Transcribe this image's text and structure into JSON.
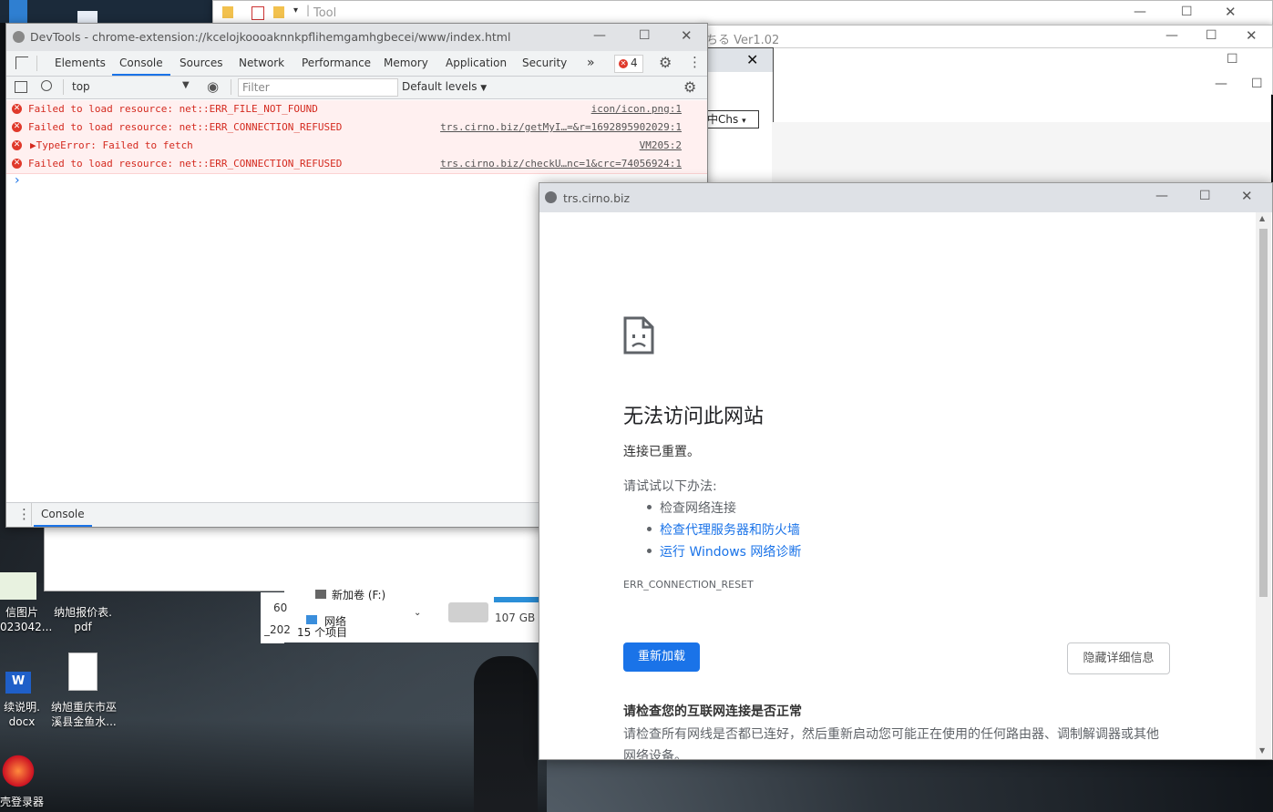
{
  "background_windows": {
    "explorer_title": "Tool",
    "version_window_title": "ちる Ver1.02",
    "language_select": "中Chs",
    "drive_label": "新加卷 (F:)",
    "network_label": "网络",
    "items_count": "15 个项目",
    "disk_free": "107 GB",
    "frag1": "60",
    "frag2": "_202"
  },
  "desktop_icons": [
    {
      "label": "信图片\n023042..."
    },
    {
      "label": "纳旭报价表.\npdf"
    },
    {
      "label": "续说明.\ndocx"
    },
    {
      "label": "纳旭重庆市巫\n溪县金鱼水..."
    },
    {
      "label": "壳登录器"
    }
  ],
  "devtools": {
    "title": "DevTools - chrome-extension://kcelojkoooaknnkpflihemgamhgbecei/www/index.html",
    "tabs": [
      "Elements",
      "Console",
      "Sources",
      "Network",
      "Performance",
      "Memory",
      "Application",
      "Security"
    ],
    "active_tab": "Console",
    "more_tabs": "»",
    "error_count": "4",
    "context": "top",
    "filter_placeholder": "Filter",
    "levels": "Default levels",
    "messages": [
      {
        "text": "Failed to load resource: net::ERR_FILE_NOT_FOUND",
        "source": "icon/icon.png:1"
      },
      {
        "text": "Failed to load resource: net::ERR_CONNECTION_REFUSED",
        "source": "trs.cirno.biz/getMyI…=&r=1692895902029:1"
      },
      {
        "text": "▶TypeError: Failed to fetch",
        "source": "VM205:2"
      },
      {
        "text": "Failed to load resource: net::ERR_CONNECTION_REFUSED",
        "source": "trs.cirno.biz/checkU…nc=1&crc=74056924:1"
      }
    ],
    "prompt": "›",
    "drawer_tab": "Console"
  },
  "error_page": {
    "url": "trs.cirno.biz",
    "heading": "无法访问此网站",
    "subheading": "连接已重置。",
    "try_label": "请试试以下办法:",
    "suggestions": [
      {
        "text": "检查网络连接",
        "link": false
      },
      {
        "text": "检查代理服务器和防火墙",
        "link": true
      },
      {
        "text": "运行 Windows 网络诊断",
        "link": true
      }
    ],
    "error_code": "ERR_CONNECTION_RESET",
    "reload_button": "重新加载",
    "details_button": "隐藏详细信息",
    "details_heading": "请检查您的互联网连接是否正常",
    "details_text": "请检查所有网线是否都已连好，然后重新启动您可能正在使用的任何路由器、调制解调器或其他网络设备。"
  },
  "colors": {
    "link_blue": "#1a73e8",
    "error_red": "#d42a1f",
    "error_bg": "#fff0f0"
  }
}
